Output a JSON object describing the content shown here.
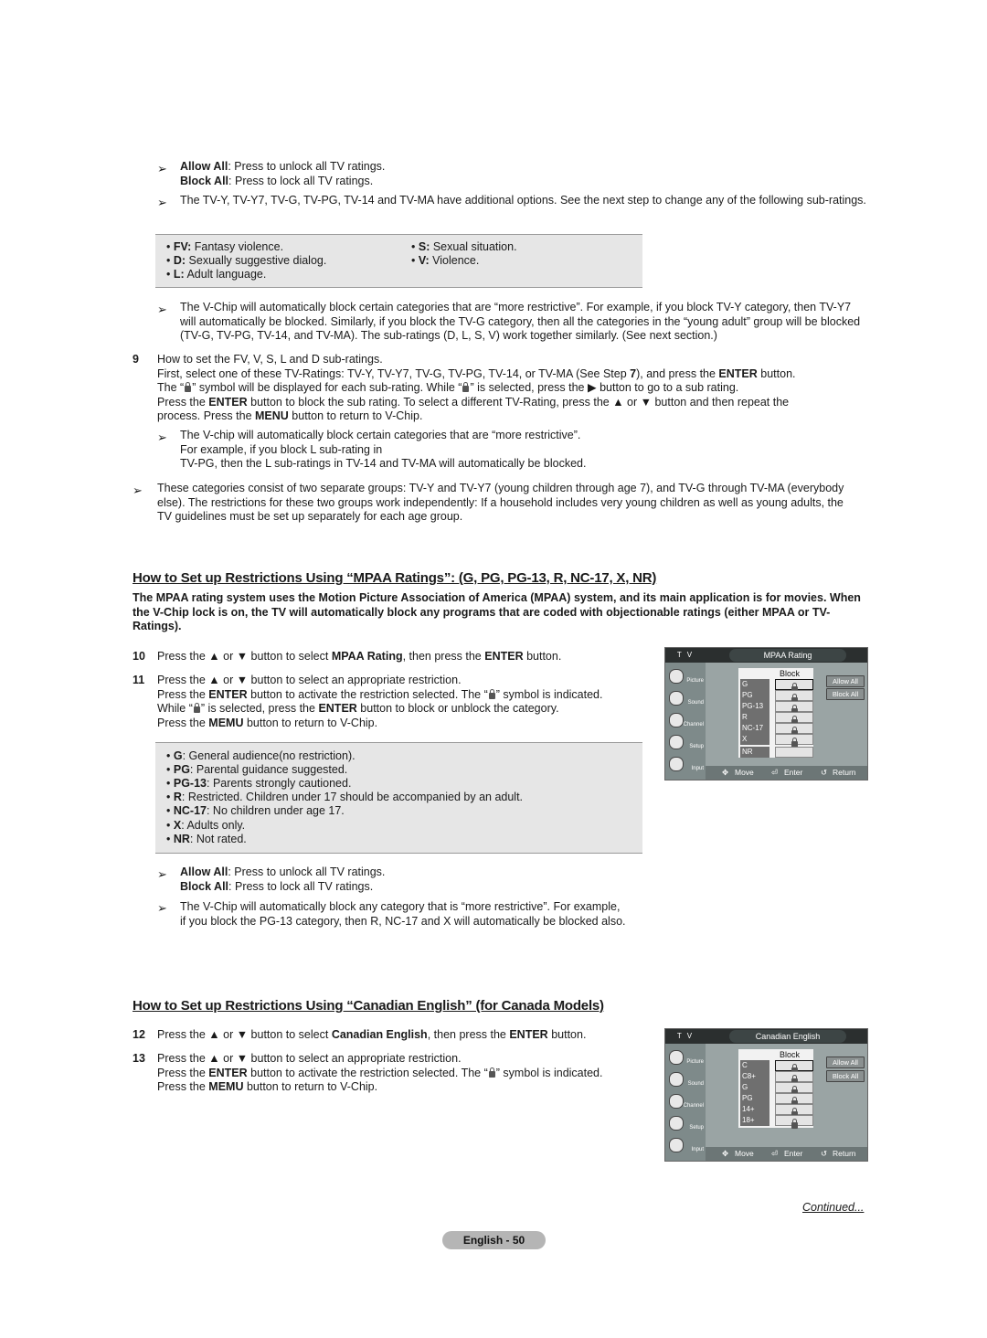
{
  "top_notes": {
    "allow_all_label": "Allow All",
    "allow_all_text": ": Press to unlock all TV ratings.",
    "block_all_label": "Block All",
    "block_all_text": ": Press to lock all TV ratings.",
    "additional_options": "The TV-Y, TV-Y7, TV-G, TV-PG, TV-14 and TV-MA have additional options. See the next step to change any of the following sub-ratings."
  },
  "subratings": [
    {
      "code": "FV:",
      "desc": " Fantasy violence."
    },
    {
      "code": "D:",
      "desc": " Sexually suggestive dialog."
    },
    {
      "code": "L:",
      "desc": " Adult language."
    },
    {
      "code": "S:",
      "desc": " Sexual situation."
    },
    {
      "code": "V:",
      "desc": " Violence."
    }
  ],
  "vchip_note_1": "The V-Chip will automatically block certain categories that are “more restrictive”. For example, if you block TV-Y category, then TV-Y7 will automatically be blocked. Similarly, if you block the TV-G category, then all the categories in the “young adult” group will be blocked (TV-G, TV-PG, TV-14, and TV-MA). The sub-ratings (D, L, S, V) work together similarly. (See next section.)",
  "step9": {
    "number": "9",
    "line1": "How to set the FV, V, S, L and D sub-ratings.",
    "line2a": "First, select one of these TV-Ratings: TV-Y, TV-Y7, TV-G, TV-PG, TV-14, or TV-MA (See Step ",
    "line2b": "7",
    "line2c": "), and press the ",
    "line2d": "ENTER",
    "line2e": " button.",
    "line3a": "The “",
    "line3b": "” symbol will be displayed for each sub-rating. While “",
    "line3c": "” is selected, press the ▶ button to go to a sub rating.",
    "line4a": "Press the ",
    "line4b": "ENTER",
    "line4c": " button to block the sub rating. To select a different TV-Rating, press the ▲ or ▼ button and then repeat the",
    "line5a": "process. Press the ",
    "line5b": "MENU",
    "line5c": " button to return to V-Chip.",
    "note_line1": "The V-chip will automatically block certain categories that are “more restrictive”.",
    "note_line2": "For example, if you block L sub-rating in",
    "note_line3": "TV-PG, then the L sub-ratings in TV-14 and TV-MA will automatically be blocked."
  },
  "groups_note": "These categories consist of two separate groups: TV-Y and TV-Y7 (young children through age 7), and TV-G through TV-MA (everybody else). The restrictions for these two groups work independently: If a household includes very young children as well as young adults, the TV guidelines must be set up separately for each age group.",
  "mpaa_section": {
    "heading": "How to Set up Restrictions Using “MPAA Ratings”: (G, PG, PG-13, R, NC-17, X, NR)",
    "intro": "The MPAA rating system uses the Motion Picture Association of America (MPAA) system, and its main application is for movies. When the V-Chip lock is on, the TV will automatically block any programs that are coded with objectionable ratings (either MPAA or TV-Ratings).",
    "step10": {
      "number": "10",
      "a": "Press the ▲ or ▼ button to select ",
      "b": "MPAA Rating",
      "c": ", then press the ",
      "d": "ENTER",
      "e": " button."
    },
    "step11": {
      "number": "11",
      "line1": "Press the ▲ or ▼ button to select an appropriate restriction.",
      "line2a": "Press the ",
      "line2b": "ENTER",
      "line2c": " button to activate the restriction selected. The “",
      "line2d": "” symbol is indicated.",
      "line3a": "While “",
      "line3b": "” is selected, press the ",
      "line3c": "ENTER",
      "line3d": " button to block or unblock the category.",
      "line4a": "Press the ",
      "line4b": "MEMU",
      "line4c": " button to return to V-Chip."
    },
    "ratings": [
      {
        "code": "G",
        "desc": ": General audience(no restriction)."
      },
      {
        "code": "PG",
        "desc": ": Parental guidance suggested."
      },
      {
        "code": "PG-13",
        "desc": ": Parents strongly cautioned."
      },
      {
        "code": "R",
        "desc": ": Restricted. Children under 17 should be accompanied by an adult."
      },
      {
        "code": "NC-17",
        "desc": ": No children under age 17."
      },
      {
        "code": "X",
        "desc": ": Adults only."
      },
      {
        "code": "NR",
        "desc": ": Not rated."
      }
    ],
    "allow_all_label": "Allow All",
    "allow_all_text": ": Press to unlock all TV ratings.",
    "block_all_label": "Block All",
    "block_all_text": ": Press to lock all TV ratings.",
    "restrictive_note_1": "The V-Chip will automatically block any category that is “more restrictive”. For example,",
    "restrictive_note_2": "if you block the PG-13 category, then R, NC-17 and X will automatically be blocked also.",
    "osd": {
      "tv_label": "T V",
      "title": "MPAA Rating",
      "sidebar": [
        "Picture",
        "Sound",
        "Channel",
        "Setup",
        "Input"
      ],
      "column_header": "Block",
      "rows": [
        {
          "label": "G",
          "locked": true,
          "selected": true
        },
        {
          "label": "PG",
          "locked": true,
          "selected": false
        },
        {
          "label": "PG-13",
          "locked": true,
          "selected": false
        },
        {
          "label": "R",
          "locked": true,
          "selected": false
        },
        {
          "label": "NC-17",
          "locked": true,
          "selected": false
        },
        {
          "label": "X",
          "locked": true,
          "selected": false
        },
        {
          "label": "NR",
          "locked": false,
          "selected": false
        }
      ],
      "allow_all": "Allow All",
      "block_all": "Block All",
      "footer": {
        "move": "Move",
        "enter": "Enter",
        "return": "Return"
      }
    }
  },
  "canadian_section": {
    "heading": "How to Set up Restrictions Using “Canadian English” (for Canada Models)",
    "step12": {
      "number": "12",
      "a": "Press the ▲ or ▼ button to select ",
      "b": "Canadian English",
      "c": ", then press the ",
      "d": "ENTER",
      "e": " button."
    },
    "step13": {
      "number": "13",
      "line1": "Press the ▲ or ▼ button to select an appropriate restriction.",
      "line2a": "Press the ",
      "line2b": "ENTER",
      "line2c": " button to activate the restriction selected. The “",
      "line2d": "” symbol is indicated.",
      "line3a": "Press the ",
      "line3b": "MEMU",
      "line3c": " button to return to V-Chip."
    },
    "osd": {
      "tv_label": "T V",
      "title": "Canadian English",
      "sidebar": [
        "Picture",
        "Sound",
        "Channel",
        "Setup",
        "Input"
      ],
      "column_header": "Block",
      "rows": [
        {
          "label": "C",
          "locked": true,
          "selected": true
        },
        {
          "label": "C8+",
          "locked": true,
          "selected": false
        },
        {
          "label": "G",
          "locked": true,
          "selected": false
        },
        {
          "label": "PG",
          "locked": true,
          "selected": false
        },
        {
          "label": "14+",
          "locked": true,
          "selected": false
        },
        {
          "label": "18+",
          "locked": true,
          "selected": false
        }
      ],
      "allow_all": "Allow All",
      "block_all": "Block All",
      "footer": {
        "move": "Move",
        "enter": "Enter",
        "return": "Return"
      }
    }
  },
  "continued": "Continued...",
  "page_label": "English - 50",
  "arrow_glyph": "➢"
}
